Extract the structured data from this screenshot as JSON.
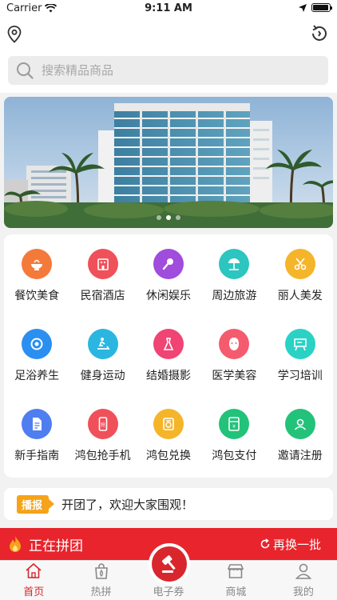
{
  "status_bar": {
    "carrier": "Carrier",
    "time": "9:11 AM",
    "battery_level": 0.95
  },
  "header": {
    "location_icon": "location-pin-icon",
    "refresh_icon": "refresh-icon"
  },
  "search": {
    "placeholder": "搜索精品商品",
    "icon": "search-icon"
  },
  "banner": {
    "slide_count": 3,
    "active_index": 1
  },
  "categories": [
    {
      "label": "餐饮美食",
      "icon": "food-bowl-icon",
      "color": "#f47a3b"
    },
    {
      "label": "民宿酒店",
      "icon": "hotel-icon",
      "color": "#f0505a"
    },
    {
      "label": "休闲娱乐",
      "icon": "microphone-icon",
      "color": "#a04cdc"
    },
    {
      "label": "周边旅游",
      "icon": "beach-umbrella-icon",
      "color": "#2dc5c0"
    },
    {
      "label": "丽人美发",
      "icon": "scissors-icon",
      "color": "#f5b52a"
    },
    {
      "label": "足浴养生",
      "icon": "spa-icon",
      "color": "#2a8ff0"
    },
    {
      "label": "健身运动",
      "icon": "treadmill-icon",
      "color": "#2ab6e0"
    },
    {
      "label": "结婚摄影",
      "icon": "wedding-dress-icon",
      "color": "#f04474"
    },
    {
      "label": "医学美容",
      "icon": "face-mask-icon",
      "color": "#f55b6e"
    },
    {
      "label": "学习培训",
      "icon": "blackboard-icon",
      "color": "#2ad2c5"
    },
    {
      "label": "新手指南",
      "icon": "document-icon",
      "color": "#4e7ef0"
    },
    {
      "label": "鸿包抢手机",
      "icon": "phone-icon",
      "color": "#f0505a"
    },
    {
      "label": "鸿包兑换",
      "icon": "exchange-icon",
      "color": "#f5b52a"
    },
    {
      "label": "鸿包支付",
      "icon": "wallet-icon",
      "color": "#22c27a"
    },
    {
      "label": "邀请注册",
      "icon": "invite-user-icon",
      "color": "#22c27a"
    }
  ],
  "notice": {
    "tag": "播报",
    "message": "开团了，欢迎大家围观！"
  },
  "group_bar": {
    "title": "正在拼团",
    "refresh_label": "再换一批"
  },
  "tabs": [
    {
      "label": "首页",
      "icon": "home-icon",
      "active": true
    },
    {
      "label": "热拼",
      "icon": "hot-bag-icon",
      "active": false
    },
    {
      "label": "电子券",
      "icon": "gavel-icon",
      "active": false
    },
    {
      "label": "商城",
      "icon": "store-icon",
      "active": false
    },
    {
      "label": "我的",
      "icon": "user-icon",
      "active": false
    }
  ],
  "colors": {
    "brand_red": "#e8242c",
    "notice_orange": "#f5a31a"
  }
}
